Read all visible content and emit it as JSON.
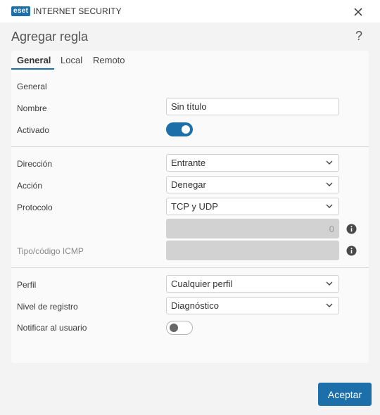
{
  "titlebar": {
    "logo_badge": "eset",
    "product_name": "INTERNET SECURITY"
  },
  "dialog": {
    "title": "Agregar regla",
    "help": "?"
  },
  "tabs": [
    {
      "label": "General",
      "active": true
    },
    {
      "label": "Local",
      "active": false
    },
    {
      "label": "Remoto",
      "active": false
    }
  ],
  "general": {
    "section_label": "General",
    "name_label": "Nombre",
    "name_value": "Sin título",
    "enabled_label": "Activado",
    "enabled": true
  },
  "rule": {
    "direction_label": "Dirección",
    "direction_value": "Entrante",
    "action_label": "Acción",
    "action_value": "Denegar",
    "protocol_label": "Protocolo",
    "protocol_value": "TCP y UDP",
    "protocol_number": "0",
    "icmp_label": "Tipo/código ICMP",
    "icmp_value": ""
  },
  "profile": {
    "profile_label": "Perfil",
    "profile_value": "Cualquier perfil",
    "log_level_label": "Nivel de registro",
    "log_level_value": "Diagnóstico",
    "notify_label": "Notificar al usuario",
    "notify": false
  },
  "footer": {
    "accept_label": "Aceptar"
  },
  "colors": {
    "accent": "#1c6fa8",
    "background": "#f3f3f3",
    "panel": "#fafafa"
  }
}
